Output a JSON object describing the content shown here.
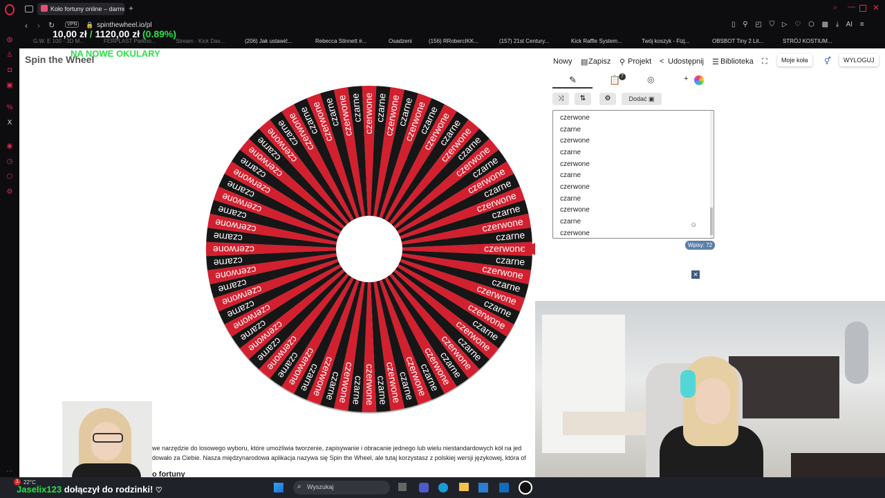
{
  "browser": {
    "tab_title": "Koło fortuny online – darmo",
    "vpn_label": "VPN",
    "url": "spinthewheel.io/pl"
  },
  "stream_overlay": {
    "balance": "10,00 zł",
    "separator": "/",
    "goal": "1120,00 zł",
    "percent": "(0.89%)",
    "banner": "NA NOWE OKULARY",
    "follow_text": "dołączył do rodzinki!",
    "follower_name": "Jaselix123"
  },
  "bookmarks": [
    "G.W. E 100 - 3D M...",
    "FERPLAST Parkho...",
    "Stream - Kick Das...",
    "(206) Jak ustawić...",
    "Rebecca Stinnett #...",
    "Osadzeni",
    "(156) RRobercIKK...",
    "(157) 21st Century...",
    "Kick Raffle System...",
    "Twój koszyk - Fizj...",
    "OBSBOT Tiny 2 Lit...",
    "STRÓJ KOSTIUM..."
  ],
  "site": {
    "logo": "Spin the Wheel",
    "nav": {
      "new": "Nowy",
      "save": "Zapisz",
      "project": "Projekt",
      "share": "Udostępnij",
      "library": "Biblioteka",
      "my_wheels": "Moje koła",
      "logout": "WYLOGUJ"
    },
    "editor": {
      "add_image": "Dodać",
      "badge_count": "7",
      "entries": [
        "czerwone",
        "czarne",
        "czerwone",
        "czarne",
        "czerwone",
        "czarne",
        "czerwone",
        "czarne",
        "czerwone",
        "czarne",
        "czerwone"
      ],
      "entry_count": "Wpisy: 72"
    },
    "wheel": {
      "segments": 72,
      "labels": [
        "czerwone",
        "czarne"
      ],
      "colors": [
        "#d2202f",
        "#161616"
      ]
    },
    "description": {
      "line1": "we narzędzie do losowego wyboru, które umożliwia tworzenie, zapisywanie i obracanie jednego lub wielu niestandardowych kół na jed",
      "line2": "dowało za Ciebie. Nasza międzynarodowa aplikacja nazywa się Spin the Wheel, ale tutaj korzystasz z polskiej wersji językowej, która of",
      "heading_partial": "o fortuny"
    }
  },
  "taskbar": {
    "weather": "22°C",
    "notification_count": "1",
    "search_placeholder": "Wyszukaj"
  },
  "colors": {
    "accent_green": "#2be04a",
    "wheel_red": "#d2202f",
    "wheel_black": "#161616",
    "opera_red": "#e0294f",
    "badge_blue": "#5b7fa6"
  }
}
